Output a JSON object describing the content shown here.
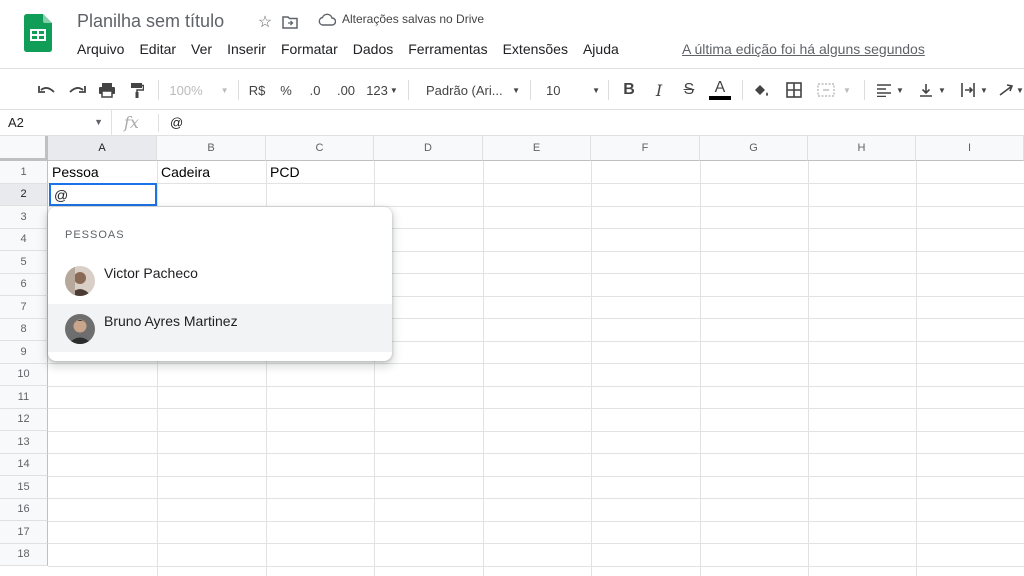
{
  "app": {
    "title": "Planilha sem título",
    "save_status": "Alterações salvas no Drive",
    "last_edit": "A última edição foi há alguns segundos"
  },
  "menu": [
    "Arquivo",
    "Editar",
    "Ver",
    "Inserir",
    "Formatar",
    "Dados",
    "Ferramentas",
    "Extensões",
    "Ajuda"
  ],
  "toolbar": {
    "zoom": "100%",
    "currency": "R$",
    "percent": "%",
    "dec_less": ".0",
    "dec_more": ".00",
    "format_more": "123",
    "font": "Padrão (Ari...",
    "font_size": "10",
    "bold": "B",
    "italic": "I",
    "strike": "S",
    "text_color_letter": "A",
    "text_color": "#000000"
  },
  "formula_bar": {
    "cell_ref": "A2",
    "fx": "fx",
    "value": "@"
  },
  "columns": [
    "A",
    "B",
    "C",
    "D",
    "E",
    "F",
    "G",
    "H",
    "I"
  ],
  "rows": [
    "1",
    "2",
    "3",
    "4",
    "5",
    "6",
    "7",
    "8",
    "9",
    "10",
    "11",
    "12",
    "13",
    "14",
    "15",
    "16",
    "17",
    "18"
  ],
  "cells": {
    "A1": "Pessoa",
    "B1": "Cadeira",
    "C1": "PCD",
    "A2": "@"
  },
  "mention_popup": {
    "section_label": "PESSOAS",
    "people": [
      {
        "name": "Victor Pacheco"
      },
      {
        "name": "Bruno Ayres Martinez"
      }
    ]
  },
  "colors": {
    "selection": "#1a73e8",
    "sheets_green": "#0f9d58"
  }
}
